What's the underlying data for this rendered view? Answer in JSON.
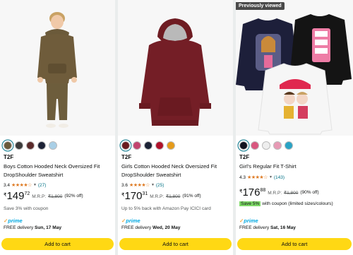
{
  "products": [
    {
      "badge": "",
      "swatches": [
        "#6b5a3a",
        "#3b3b3b",
        "#5a2a2a",
        "#1c2235",
        "#a9cfe6"
      ],
      "brand": "T2F",
      "title": "Boys Cotton Hooded Neck Oversized Fit DropShoulder Sweatshirt",
      "rating_value": "3.4",
      "stars": "★★★★☆",
      "rating_count": "(27)",
      "currency": "₹",
      "price_whole": "149",
      "price_fraction": "72",
      "mrp_label": "M.R.P:",
      "mrp_value": "₹1,800",
      "discount": "(92% off)",
      "offer_prefix": "",
      "offer_text": "Save 3% with coupon",
      "prime_label": "prime",
      "delivery_prefix": "FREE delivery",
      "delivery_date": "Sun, 17 May",
      "cart_label": "Add to cart"
    },
    {
      "badge": "",
      "swatches": [
        "#6a1b1f",
        "#c2446e",
        "#1c2235",
        "#b0112a",
        "#e59b1a"
      ],
      "brand": "T2F",
      "title": "Girls Cotton Hooded Neck Oversized Fit DropShoulder Sweatshirt",
      "rating_value": "3.6",
      "stars": "★★★★☆",
      "rating_count": "(25)",
      "currency": "₹",
      "price_whole": "170",
      "price_fraction": "31",
      "mrp_label": "M.R.P:",
      "mrp_value": "₹1,800",
      "discount": "(91% off)",
      "offer_prefix": "",
      "offer_text": "Up to 5% back with Amazon Pay ICICI card",
      "prime_label": "prime",
      "delivery_prefix": "FREE delivery",
      "delivery_date": "Wed, 20 May",
      "cart_label": "Add to cart"
    },
    {
      "badge": "Previously viewed",
      "swatches": [
        "#12131f",
        "#d9577f",
        "#eeeeee",
        "#e79ab5",
        "#2aa3c4"
      ],
      "brand": "T2F",
      "title": "Girl's Regular Fit T-Shirt",
      "rating_value": "4.3",
      "stars": "★★★★☆",
      "rating_count": "(143)",
      "currency": "₹",
      "price_whole": "176",
      "price_fraction": "88",
      "mrp_label": "M.R.P:",
      "mrp_value": "₹1,800",
      "discount": "(90% off)",
      "offer_prefix": "Save 5%",
      "offer_text": " with coupon (limited sizes/colours)",
      "prime_label": "prime",
      "delivery_prefix": "FREE delivery",
      "delivery_date": "Sat, 16 May",
      "cart_label": "Add to cart"
    }
  ],
  "icons": {
    "rating_caret": "chevron-down-icon",
    "prime_check": "check-icon"
  }
}
